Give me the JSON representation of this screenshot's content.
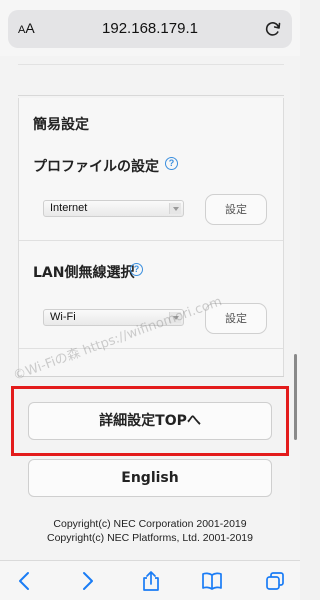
{
  "browser": {
    "aa_label_large": "A",
    "aa_label_small": "A",
    "url": "192.168.179.1"
  },
  "section": {
    "title": "簡易設定",
    "profile": {
      "label": "プロファイルの設定",
      "help": "?",
      "selected": "Internet",
      "button": "設定"
    },
    "lan": {
      "label": "LAN側無線選択",
      "help": "?",
      "selected": "Wi-Fi",
      "button": "設定"
    }
  },
  "buttons": {
    "detail_top": "詳細設定TOPへ",
    "english": "English"
  },
  "footer": {
    "copyright1": "Copyright(c) NEC Corporation 2001-2019",
    "copyright2": "Copyright(c) NEC Platforms, Ltd. 2001-2019"
  },
  "watermark": "©Wi-Fiの森 https://wifinomori.com",
  "colors": {
    "highlight": "#e31b1b",
    "help_icon": "#3b8fde",
    "toolbar_icons": "#1a7cf5"
  },
  "icons": [
    "reload-icon",
    "back-icon",
    "forward-icon",
    "share-icon",
    "bookmarks-icon",
    "tabs-icon"
  ]
}
